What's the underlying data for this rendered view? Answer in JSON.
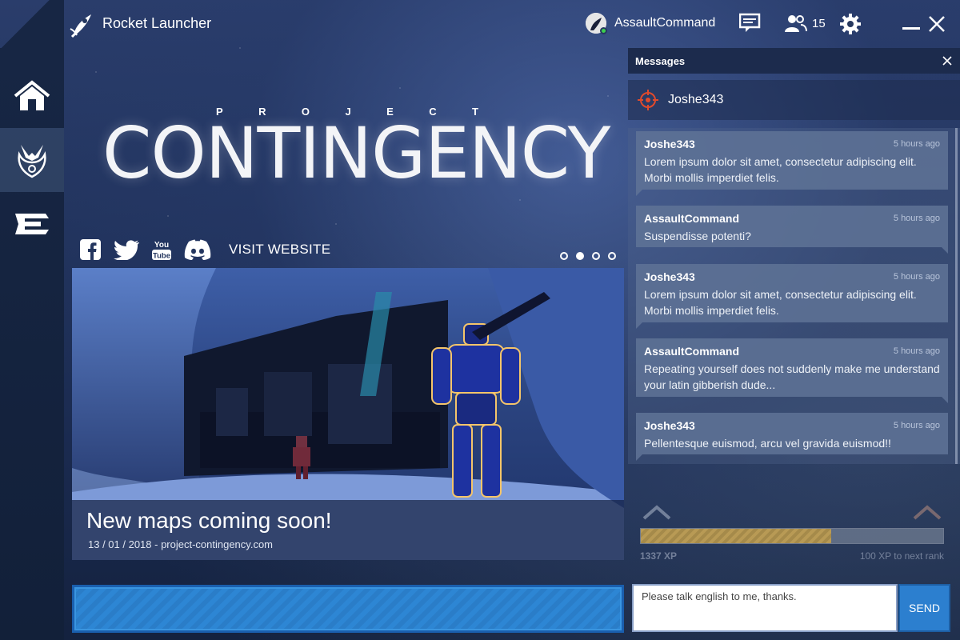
{
  "app": {
    "title": "Rocket Launcher"
  },
  "user": {
    "name": "AssaultCommand",
    "status_color": "#3ccf4e"
  },
  "friends": {
    "count": "15"
  },
  "nav": {
    "items": [
      {
        "name": "home",
        "icon": "home-icon"
      },
      {
        "name": "game",
        "icon": "eagle-emblem-icon"
      },
      {
        "name": "store",
        "icon": "launcher-emblem-icon"
      }
    ],
    "active_index": 1
  },
  "banner": {
    "project": [
      "P",
      "R",
      "O",
      "J",
      "E",
      "C",
      "T"
    ],
    "game_title": "CONTINGENCY",
    "visit_label": "VISIT WEBSITE",
    "slide_count": 4,
    "active_slide": 1
  },
  "news": {
    "title": "New maps coming soon!",
    "subtitle": "13 / 01 / 2018 - project-contingency.com"
  },
  "messages": {
    "header": "Messages",
    "contact": "Joshe343",
    "thread": [
      {
        "author": "Joshe343",
        "time": "5 hours ago",
        "text": "Lorem ipsum dolor sit amet, consectetur adipiscing elit. Morbi mollis imperdiet felis.",
        "side": "them"
      },
      {
        "author": "AssaultCommand",
        "time": "5 hours ago",
        "text": "Suspendisse potenti?",
        "side": "me"
      },
      {
        "author": "Joshe343",
        "time": "5 hours ago",
        "text": "Lorem ipsum dolor sit amet, consectetur adipiscing elit. Morbi mollis imperdiet felis.",
        "side": "them"
      },
      {
        "author": "AssaultCommand",
        "time": "5 hours ago",
        "text": "Repeating yourself does not suddenly make me understand your latin gibberish dude...",
        "side": "me"
      },
      {
        "author": "Joshe343",
        "time": "5 hours ago",
        "text": "Pellentesque euismod, arcu vel gravida euismod!!",
        "side": "them"
      }
    ],
    "input_value": "Please talk english to me, thanks.",
    "send_label": "SEND"
  },
  "rank": {
    "xp_label": "1337 XP",
    "next_label": "100 XP to next rank",
    "progress": 0.63
  },
  "colors": {
    "accent": "#2c7fcf",
    "panel": "#1c2b4d",
    "xp": "#b89a55"
  }
}
